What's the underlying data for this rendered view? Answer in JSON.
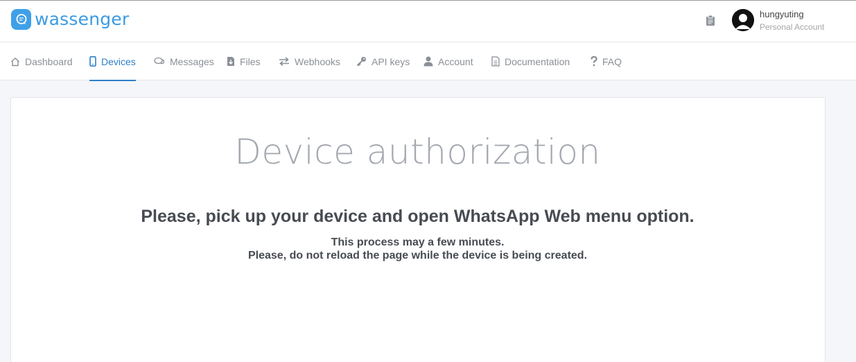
{
  "brand": {
    "name": "wassenger",
    "logo_icon": "chat-bubble-icon",
    "color": "#3b9be3"
  },
  "user": {
    "name": "hungyuting",
    "account_type": "Personal Account",
    "avatar_icon": "user-avatar-icon"
  },
  "header": {
    "clipboard_icon": "clipboard-icon"
  },
  "nav": {
    "active_color": "#2d7fc9",
    "items": [
      {
        "label": "Dashboard",
        "icon": "home-icon"
      },
      {
        "label": "Devices",
        "icon": "mobile-icon",
        "active": true
      },
      {
        "label": "Messages",
        "icon": "chat-icon"
      },
      {
        "label": "Files",
        "icon": "file-download-icon"
      },
      {
        "label": "Webhooks",
        "icon": "exchange-icon"
      },
      {
        "label": "API keys",
        "icon": "key-icon"
      },
      {
        "label": "Account",
        "icon": "user-icon"
      },
      {
        "label": "Documentation",
        "icon": "document-icon"
      },
      {
        "label": "FAQ",
        "icon": "question-icon"
      }
    ]
  },
  "main": {
    "title": "Device authorization",
    "heading": "Please, pick up your device and open WhatsApp Web menu option.",
    "line1": "This process may a few minutes.",
    "line2": "Please, do not reload the page while the device is being created."
  }
}
